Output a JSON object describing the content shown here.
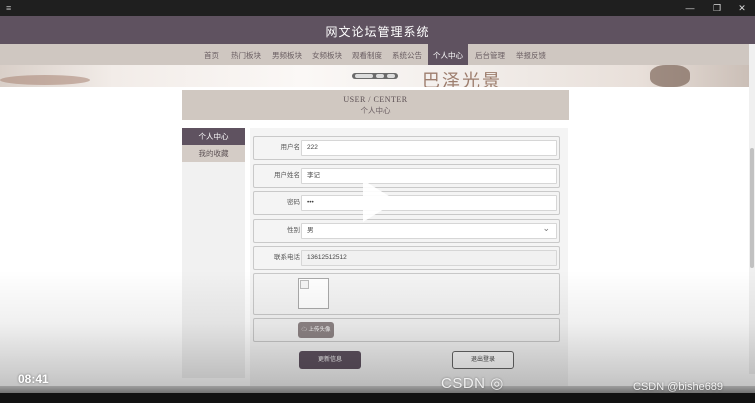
{
  "window": {
    "menu_icon": "hamburger-icon",
    "controls": [
      "minimize-icon",
      "restore-icon",
      "close-icon"
    ]
  },
  "site": {
    "title": "网文论坛管理系统"
  },
  "nav": {
    "items": [
      "首页",
      "热门板块",
      "男频板块",
      "女频板块",
      "观看制度",
      "系统公告",
      "个人中心",
      "后台管理",
      "举报反馈"
    ],
    "active": "个人中心"
  },
  "banner": {
    "calligraphy": "巴泽光景"
  },
  "page_title": {
    "en": "USER / CENTER",
    "cn": "个人中心"
  },
  "sidebar": {
    "items": [
      {
        "label": "个人中心",
        "active": true
      },
      {
        "label": "我的收藏",
        "active": false
      }
    ]
  },
  "form": {
    "username": {
      "label": "用户名",
      "value": "222"
    },
    "fullname": {
      "label": "用户姓名",
      "value": "李记"
    },
    "password": {
      "label": "密码",
      "value": "•••"
    },
    "gender": {
      "label": "性别",
      "value": "男"
    },
    "phone": {
      "label": "联系电话",
      "value": "13612512512"
    },
    "upload_label": "上传头像",
    "update_button": "更新信息",
    "logout_button": "退出登录"
  },
  "video": {
    "time": "08:41",
    "watermark_center": "CSDN",
    "watermark_right": "CSDN @bishe689"
  },
  "colors": {
    "primary": "#5f5260",
    "nav_bg": "#cfc7c1",
    "title_bg": "#d0c8c1"
  }
}
